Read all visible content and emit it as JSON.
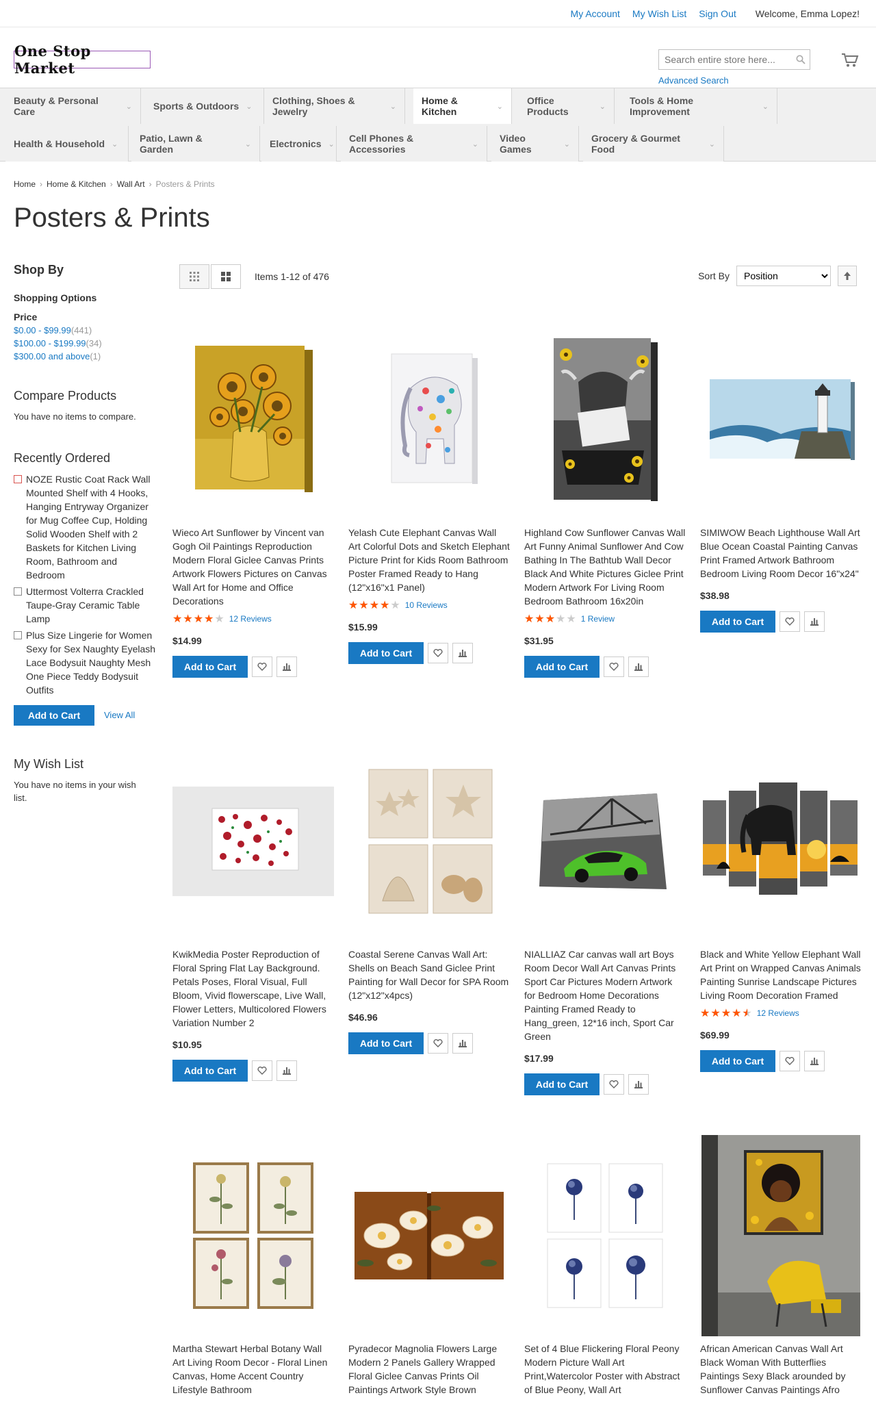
{
  "top_links": {
    "account": "My Account",
    "wishlist": "My Wish List",
    "signout": "Sign Out",
    "welcome": "Welcome, Emma Lopez!"
  },
  "header": {
    "logo": "One Stop Market",
    "search_placeholder": "Search entire store here...",
    "advanced_search": "Advanced Search"
  },
  "nav": [
    {
      "label": "Beauty & Personal Care"
    },
    {
      "label": "Sports & Outdoors"
    },
    {
      "label": "Clothing, Shoes & Jewelry"
    },
    {
      "label": "Home & Kitchen"
    },
    {
      "label": "Office Products"
    },
    {
      "label": "Tools & Home Improvement"
    },
    {
      "label": "Health & Household"
    },
    {
      "label": "Patio, Lawn & Garden"
    },
    {
      "label": "Electronics"
    },
    {
      "label": "Cell Phones & Accessories"
    },
    {
      "label": "Video Games"
    },
    {
      "label": "Grocery & Gourmet Food"
    }
  ],
  "breadcrumbs": {
    "home": "Home",
    "home_kitchen": "Home & Kitchen",
    "wall_art": "Wall Art",
    "current": "Posters & Prints"
  },
  "page_title": "Posters & Prints",
  "sidebar": {
    "shop_by": "Shop By",
    "shopping_options": "Shopping Options",
    "price": "Price",
    "price_ranges": [
      {
        "label": "$0.00 - $99.99",
        "count": "441"
      },
      {
        "label": "$100.00 - $199.99",
        "count": "34"
      },
      {
        "label": "$300.00 and above",
        "count": "1"
      }
    ],
    "compare_title": "Compare Products",
    "compare_text": "You have no items to compare.",
    "recent_title": "Recently Ordered",
    "recent_items": [
      "NOZE Rustic Coat Rack Wall Mounted Shelf with 4 Hooks, Hanging Entryway Organizer for Mug Coffee Cup, Holding Solid Wooden Shelf with 2 Baskets for Kitchen Living Room, Bathroom and Bedroom",
      "Uttermost Volterra Crackled Taupe-Gray Ceramic Table Lamp",
      "Plus Size Lingerie for Women Sexy for Sex Naughty Eyelash Lace Bodysuit Naughty Mesh One Piece Teddy Bodysuit Outfits"
    ],
    "add_to_cart": "Add to Cart",
    "view_all": "View All",
    "wishlist_title": "My Wish List",
    "wishlist_text": "You have no items in your wish list."
  },
  "toolbar": {
    "amount": "Items 1-12 of 476",
    "sort_by": "Sort By",
    "sort_selected": "Position"
  },
  "products": [
    {
      "name": "Wieco Art Sunflower by Vincent van Gogh Oil Paintings Reproduction Modern Floral Giclee Canvas Prints Artwork Flowers Pictures on Canvas Wall Art for Home and Office Decorations",
      "rating": 0.8,
      "reviews": "12  Reviews",
      "price": "$14.99"
    },
    {
      "name": "Yelash Cute Elephant Canvas Wall Art Colorful Dots and Sketch Elephant Picture Print for Kids Room Bathroom Poster Framed Ready to Hang (12\"x16\"x1 Panel)",
      "rating": 0.8,
      "reviews": "10  Reviews",
      "price": "$15.99"
    },
    {
      "name": "Highland Cow Sunflower Canvas Wall Art Funny Animal Sunflower And Cow Bathing In The Bathtub Wall Decor Black And White Pictures Giclee Print Modern Artwork For Living Room Bedroom Bathroom 16x20in",
      "rating": 0.6,
      "reviews": "1  Review",
      "price": "$31.95"
    },
    {
      "name": "SIMIWOW Beach Lighthouse Wall Art Blue Ocean Coastal Painting Canvas Print Framed Artwork Bathroom Bedroom Living Room Decor 16\"x24\"",
      "rating": null,
      "reviews": "",
      "price": "$38.98"
    },
    {
      "name": "KwikMedia Poster Reproduction of Floral Spring Flat Lay Background. Petals Poses, Floral Visual, Full Bloom, Vivid flowerscape, Live Wall, Flower Letters, Multicolored Flowers Variation Number 2",
      "rating": null,
      "reviews": "",
      "price": "$10.95"
    },
    {
      "name": "Coastal Serene Canvas Wall Art: Shells on Beach Sand Giclee Print Painting for Wall Decor for SPA Room (12\"x12\"x4pcs)",
      "rating": null,
      "reviews": "",
      "price": "$46.96"
    },
    {
      "name": "NIALLIAZ Car canvas wall art Boys Room Decor Wall Art Canvas Prints Sport Car Pictures Modern Artwork for Bedroom Home Decorations Painting Framed Ready to Hang_green, 12*16 inch, Sport Car Green",
      "rating": null,
      "reviews": "",
      "price": "$17.99"
    },
    {
      "name": "Black and White Yellow Elephant Wall Art Print on Wrapped Canvas Animals Painting Sunrise Landscape Pictures Living Room Decoration Framed",
      "rating": 0.9,
      "reviews": "12  Reviews",
      "price": "$69.99"
    },
    {
      "name": "Martha Stewart Herbal Botany Wall Art Living Room Decor - Floral Linen Canvas, Home Accent Country Lifestyle Bathroom",
      "rating": null,
      "reviews": "",
      "price": ""
    },
    {
      "name": "Pyradecor Magnolia Flowers Large Modern 2 Panels Gallery Wrapped Floral Giclee Canvas Prints Oil Paintings Artwork Style Brown",
      "rating": null,
      "reviews": "",
      "price": ""
    },
    {
      "name": "Set of 4 Blue Flickering Floral Peony Modern Picture Wall Art Print,Watercolor Poster with Abstract of Blue Peony, Wall Art",
      "rating": null,
      "reviews": "",
      "price": ""
    },
    {
      "name": "African American Canvas Wall Art Black Woman With Butterflies Paintings Sexy Black arounded by Sunflower Canvas Paintings Afro",
      "rating": null,
      "reviews": "",
      "price": ""
    }
  ],
  "product_add_label": "Add to Cart",
  "icons": {
    "cart": "cart-icon",
    "search": "search-icon",
    "wishlist": "heart-icon",
    "compare": "compare-icon",
    "grid": "grid-icon",
    "list": "list-icon",
    "sort": "arrow-up-icon"
  },
  "colors": {
    "accent": "#1979c3",
    "star": "#ff5501"
  }
}
